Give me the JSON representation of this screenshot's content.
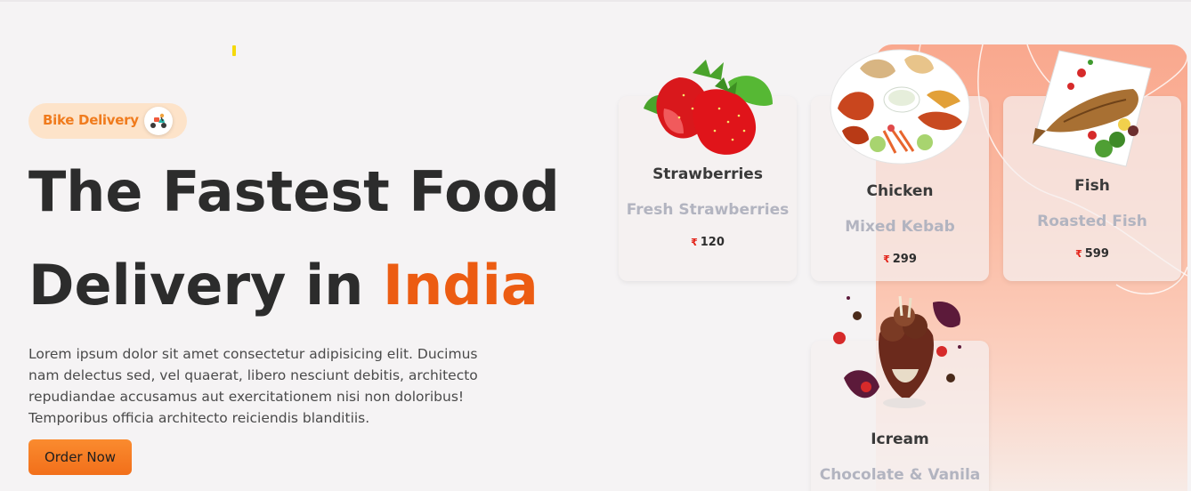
{
  "hero": {
    "badge_label": "Bike Delivery",
    "badge_icon": "scooter-icon",
    "headline_line1": "The Fastest Food",
    "headline_line2_prefix": "Delivery in",
    "headline_accent": "India",
    "description": "Lorem ipsum dolor sit amet consectetur adipisicing elit. Ducimus nam delectus sed, vel quaerat, libero nesciunt debitis, architecto repudiandae accusamus aut exercitationem nisi non doloribus! Temporibus officia architecto reiciendis blanditiis.",
    "order_button": "Order Now"
  },
  "colors": {
    "accent": "#ec5c12",
    "button": "#f57b22",
    "badge_bg": "#fde3c9",
    "hero_panel": "#f9a88e"
  },
  "menu": [
    {
      "title": "Strawberries",
      "subtitle": "Fresh Strawberries",
      "currency": "₹",
      "price": "120",
      "image": "strawberry-image"
    },
    {
      "title": "Chicken",
      "subtitle": "Mixed Kebab",
      "currency": "₹",
      "price": "299",
      "image": "kebab-platter-image"
    },
    {
      "title": "Fish",
      "subtitle": "Roasted Fish",
      "currency": "₹",
      "price": "599",
      "image": "roasted-fish-image"
    },
    {
      "title": "Icream",
      "subtitle": "Chocolate & Vanila",
      "image": "icecream-image"
    }
  ]
}
